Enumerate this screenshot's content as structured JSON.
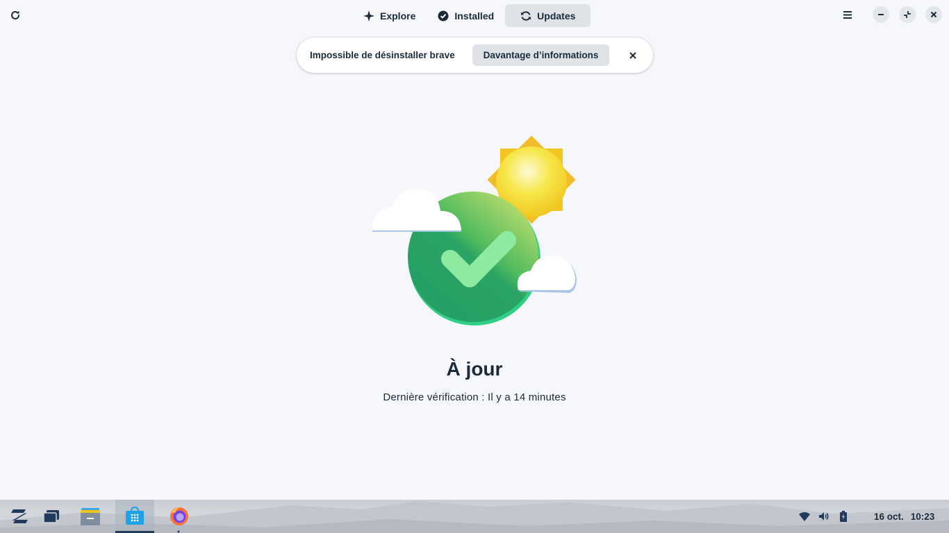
{
  "header": {
    "tabs": [
      {
        "label": "Explore",
        "icon": "sparkle-icon"
      },
      {
        "label": "Installed",
        "icon": "check-circle-icon"
      },
      {
        "label": "Updates",
        "icon": "sync-icon",
        "active": true
      }
    ]
  },
  "notification": {
    "message": "Impossible de désinstaller brave",
    "action_label": "Davantage d’informations"
  },
  "status": {
    "title": "À jour",
    "subtitle": "Dernière vérification : Il y a 14 minutes"
  },
  "taskbar": {
    "apps": [
      {
        "name": "zorin-menu",
        "icon": "zorin-logo-icon"
      },
      {
        "name": "workspaces",
        "icon": "windows-icon"
      },
      {
        "name": "files",
        "icon": "file-cabinet-icon"
      },
      {
        "name": "software",
        "icon": "software-store-icon",
        "active": true
      },
      {
        "name": "firefox",
        "icon": "firefox-icon"
      }
    ],
    "tray": [
      "wifi-icon",
      "volume-icon",
      "battery-icon"
    ],
    "date": "16 oct.",
    "time": "10:23"
  },
  "colors": {
    "background": "#f5f7fa",
    "text": "#1b2a3a",
    "active_tab": "#dfe3e8",
    "check_green": "#27a465",
    "sun_yellow": "#f6d21f"
  }
}
